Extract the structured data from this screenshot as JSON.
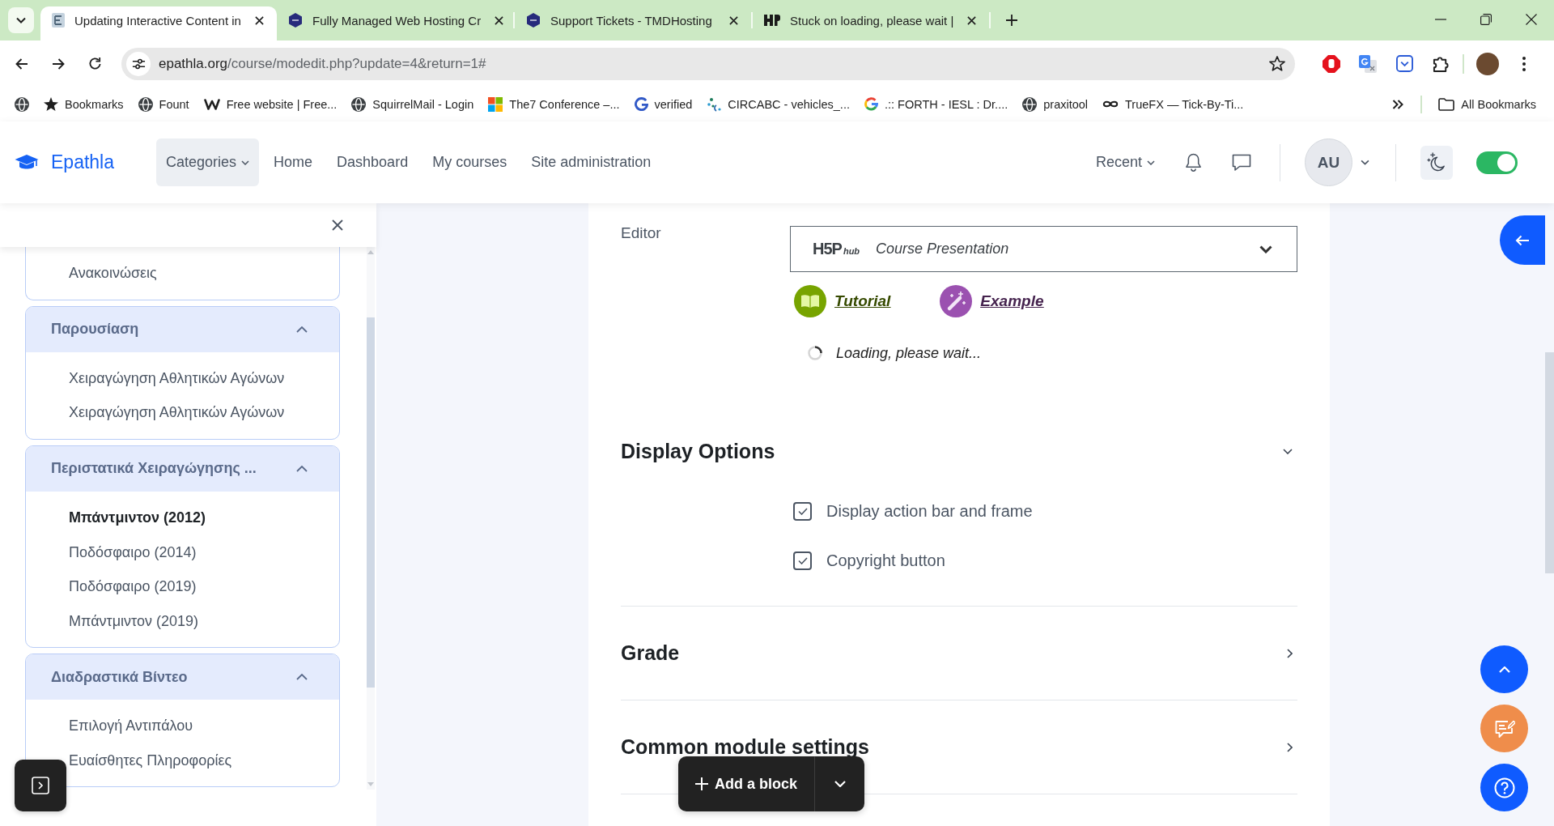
{
  "browser": {
    "tabs": [
      {
        "title": "Updating Interactive Content in",
        "selected": true,
        "kind": "doc"
      },
      {
        "title": "Fully Managed Web Hosting Cr",
        "selected": false,
        "kind": "hexagon"
      },
      {
        "title": "Support Tickets - TMDHosting",
        "selected": false,
        "kind": "hexagon"
      },
      {
        "title": "Stuck on loading, please wait |",
        "selected": false,
        "kind": "mark"
      }
    ],
    "address": {
      "host": "epathla.org",
      "path": "/course/modedit.php?update=4&return=1#"
    },
    "bookmarks": [
      {
        "kind": "globe"
      },
      {
        "label": "Bookmarks",
        "kind": "star"
      },
      {
        "label": "Fount",
        "kind": "globe"
      },
      {
        "label": "Free website | Free...",
        "kind": "zigzag"
      },
      {
        "label": "SquirrelMail - Login",
        "kind": "globe"
      },
      {
        "label": "The7 Conference –...",
        "kind": "tiles"
      },
      {
        "label": "verified",
        "kind": "g"
      },
      {
        "label": "CIRCABC - vehicles_...",
        "kind": "dots"
      },
      {
        "label": ".:: FORTH - IESL : Dr....",
        "kind": "google"
      },
      {
        "label": "praxitool",
        "kind": "globe"
      },
      {
        "label": "TrueFX — Tick-By-Ti...",
        "kind": "loop"
      }
    ],
    "all_bookmarks": "All Bookmarks"
  },
  "site": {
    "brand": "Epathla",
    "nav": [
      {
        "label": "Categories",
        "selected": true,
        "menu": true
      },
      {
        "label": "Home",
        "selected": false,
        "menu": false
      },
      {
        "label": "Dashboard",
        "selected": false,
        "menu": false
      },
      {
        "label": "My courses",
        "selected": false,
        "menu": false
      },
      {
        "label": "Site administration",
        "selected": false,
        "menu": false
      }
    ],
    "recent": "Recent",
    "user": "AU",
    "mode_switch": {
      "on": true
    }
  },
  "course_index": {
    "sections": [
      {
        "items": [
          {
            "label": "Ανακοινώσεις",
            "selected": false
          }
        ]
      },
      {
        "title": "Παρουσίαση",
        "expanded": true,
        "items": [
          {
            "label": "Χειραγώγηση Αθλητικών Αγώνων",
            "selected": false
          },
          {
            "label": "Χειραγώγηση Αθλητικών Αγώνων",
            "selected": false
          }
        ]
      },
      {
        "title": "Περιστατικά Χειραγώγησης ...",
        "expanded": true,
        "items": [
          {
            "label": "Μπάντμιντον (2012)",
            "selected": true
          },
          {
            "label": "Ποδόσφαιρο (2014)",
            "selected": false
          },
          {
            "label": "Ποδόσφαιρο (2019)",
            "selected": false
          },
          {
            "label": "Μπάντμιντον (2019)",
            "selected": false
          }
        ]
      },
      {
        "title": "Διαδραστικά Βίντεο",
        "expanded": true,
        "items": [
          {
            "label": "Επιλογή Αντιπάλου",
            "selected": false
          },
          {
            "label": "Ευαίσθητες Πληροφορίες",
            "selected": false
          }
        ]
      }
    ]
  },
  "form": {
    "editor": {
      "label": "Editor",
      "hub_logo": {
        "mark": "H5P",
        "sub": "hub"
      },
      "content_type": "Course Presentation",
      "links": [
        {
          "label": "Tutorial",
          "kind": "book",
          "color": "#77a400"
        },
        {
          "label": "Example",
          "kind": "wand",
          "color": "#9b51b0"
        }
      ],
      "status": "Loading, please wait..."
    },
    "sections": [
      {
        "title": "Display Options",
        "expanded": true,
        "options": [
          {
            "label": "Display action bar and frame",
            "checked": true
          },
          {
            "label": "Copyright button",
            "checked": true
          }
        ]
      },
      {
        "title": "Grade",
        "expanded": false
      },
      {
        "title": "Common module settings",
        "expanded": false
      }
    ]
  },
  "add_block": "Add a block"
}
